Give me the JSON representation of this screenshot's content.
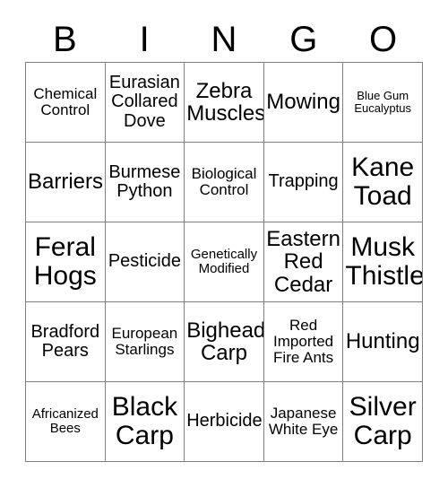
{
  "card": {
    "title": "BINGO Card",
    "header_letters": [
      "B",
      "I",
      "N",
      "G",
      "O"
    ],
    "columns": 5,
    "rows": 5,
    "colors": {
      "background": "#ffffff",
      "text": "#000000",
      "grid_line": "#808080"
    },
    "cells": [
      [
        {
          "text": "Chemical Control",
          "size": "md"
        },
        {
          "text": "Eurasian Collared Dove",
          "size": "lg"
        },
        {
          "text": "Zebra Muscles",
          "size": "xl"
        },
        {
          "text": "Mowing",
          "size": "xl"
        },
        {
          "text": "Blue Gum Eucalyptus",
          "size": "xs"
        }
      ],
      [
        {
          "text": "Barriers",
          "size": "xl"
        },
        {
          "text": "Burmese Python",
          "size": "lg"
        },
        {
          "text": "Biological Control",
          "size": "md"
        },
        {
          "text": "Trapping",
          "size": "lg"
        },
        {
          "text": "Kane Toad",
          "size": "xxl"
        }
      ],
      [
        {
          "text": "Feral Hogs",
          "size": "xxl"
        },
        {
          "text": "Pesticide",
          "size": "lg"
        },
        {
          "text": "Genetically Modified",
          "size": "sm"
        },
        {
          "text": "Eastern Red Cedar",
          "size": "xl"
        },
        {
          "text": "Musk Thistle",
          "size": "xxl"
        }
      ],
      [
        {
          "text": "Bradford Pears",
          "size": "lg"
        },
        {
          "text": "European Starlings",
          "size": "md"
        },
        {
          "text": "Bighead Carp",
          "size": "xl"
        },
        {
          "text": "Red Imported Fire Ants",
          "size": "md"
        },
        {
          "text": "Hunting",
          "size": "xl"
        }
      ],
      [
        {
          "text": "Africanized Bees",
          "size": "sm"
        },
        {
          "text": "Black Carp",
          "size": "xxl"
        },
        {
          "text": "Herbicide",
          "size": "lg"
        },
        {
          "text": "Japanese White Eye",
          "size": "md"
        },
        {
          "text": "Silver Carp",
          "size": "xxl"
        }
      ]
    ]
  }
}
